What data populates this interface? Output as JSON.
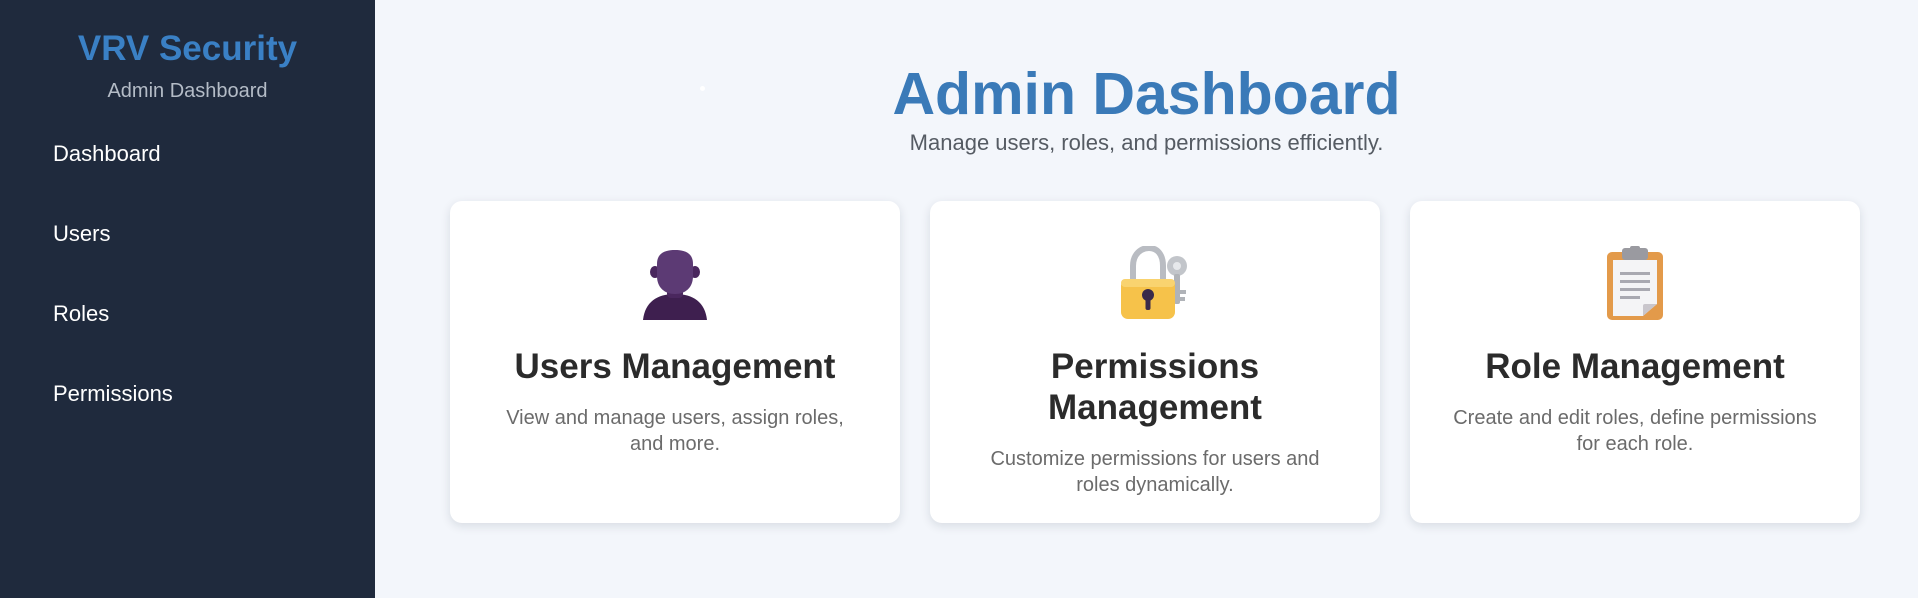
{
  "sidebar": {
    "brand_title": "VRV Security",
    "brand_subtitle": "Admin Dashboard",
    "items": [
      {
        "label": "Dashboard"
      },
      {
        "label": "Users"
      },
      {
        "label": "Roles"
      },
      {
        "label": "Permissions"
      }
    ]
  },
  "main": {
    "title": "Admin Dashboard",
    "subtitle": "Manage users, roles, and permissions efficiently.",
    "cards": [
      {
        "icon": "user-icon",
        "title": "Users Management",
        "description": "View and manage users, assign roles, and more."
      },
      {
        "icon": "lock-key-icon",
        "title": "Permissions Management",
        "description": "Customize permissions for users and roles dynamically."
      },
      {
        "icon": "clipboard-icon",
        "title": "Role Management",
        "description": "Create and edit roles, define permissions for each role."
      }
    ]
  },
  "colors": {
    "sidebar_bg": "#1f2a3d",
    "brand_blue": "#3a80c5",
    "page_bg": "#f3f6fb",
    "card_bg": "#ffffff"
  }
}
